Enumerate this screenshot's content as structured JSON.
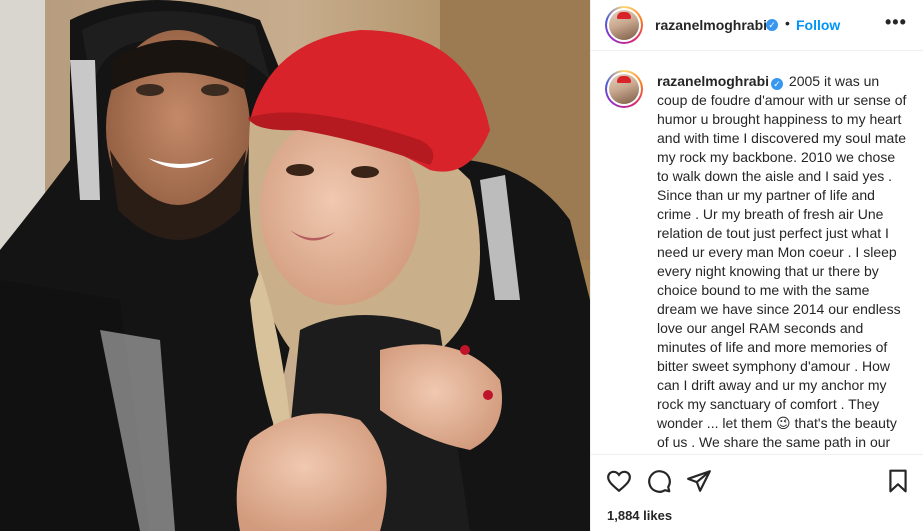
{
  "post": {
    "username": "razanelmoghrabi",
    "follow_label": "Follow",
    "dot": "•",
    "more_label": "•••",
    "verified_mark": "✓",
    "caption_username": "razanelmoghrabi",
    "caption_text": "2005 it was un coup de foudre d'amour with ur sense of humor u brought happiness to my heart and with time I discovered my soul mate my rock my backbone. 2010 we chose to walk down the aisle and I said yes . Since than ur my partner of life and crime . Ur my breath of fresh air Une relation de tout just perfect just what I need ur every man Mon coeur . I sleep every night knowing that ur there by choice bound to me with the same dream we have since 2014 our endless love our angel RAM seconds and minutes of life and more memories of bitter sweet symphony d'amour . How can I drift away and ur my anchor my rock my sanctuary of comfort . They wonder ... let them 😉 that's the beauty of us . We share the same path in our crazy way . My bou",
    "likes": "1,884 likes"
  },
  "icons": {
    "like": "heart-icon",
    "comment": "comment-icon",
    "share": "share-icon",
    "save": "bookmark-icon",
    "verified": "verified-badge-icon"
  },
  "colors": {
    "follow": "#0095f6",
    "verified": "#3897f0",
    "beret": "#d8232a"
  }
}
